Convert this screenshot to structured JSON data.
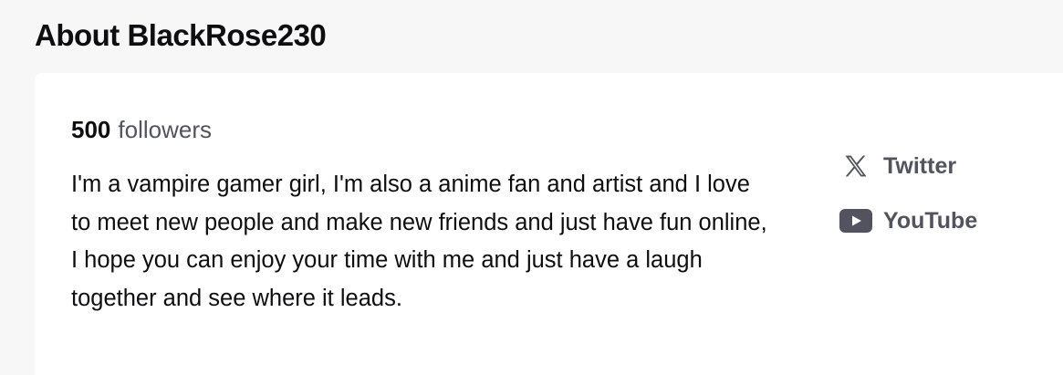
{
  "header": {
    "title": "About BlackRose230"
  },
  "profile": {
    "followers_count": "500",
    "followers_label": "followers",
    "bio": "I'm a vampire gamer girl, I'm also a anime fan and artist and I love to meet new people and make new friends and just have fun online, I hope you can enjoy your time with me and just have a laugh together and see where it leads."
  },
  "social_links": [
    {
      "label": "Twitter",
      "icon": "x-twitter-icon"
    },
    {
      "label": "YouTube",
      "icon": "youtube-icon"
    }
  ],
  "colors": {
    "page_background": "#f7f7f8",
    "card_background": "#ffffff",
    "primary_text": "#0e0e10",
    "secondary_text": "#53535f"
  }
}
